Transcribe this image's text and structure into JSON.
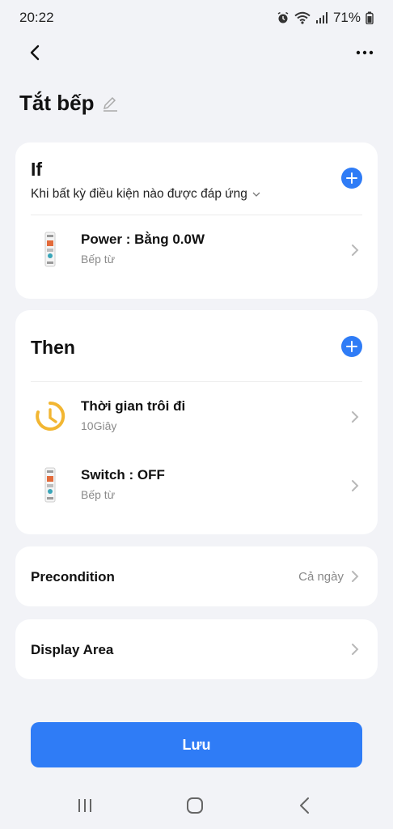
{
  "status_bar": {
    "time": "20:22",
    "battery": "71%",
    "icons": [
      "alarm-icon",
      "wifi-icon",
      "signal-icon",
      "battery-icon"
    ]
  },
  "header": {
    "title": "Tắt bếp",
    "icons": [
      "back-arrow-icon",
      "more-options-icon",
      "edit-pencil-icon"
    ]
  },
  "if_section": {
    "title": "If",
    "condition_mode": "Khi bất kỳ điều kiện nào được đáp ứng",
    "items": [
      {
        "title": "Power : Bằng 0.0W",
        "subtitle": "Bếp từ",
        "icon": "breaker-device-icon"
      }
    ]
  },
  "then_section": {
    "title": "Then",
    "items": [
      {
        "title": "Thời gian trôi đi",
        "subtitle": "10Giây",
        "icon": "delay-clock-icon"
      },
      {
        "title": "Switch : OFF",
        "subtitle": "Bếp từ",
        "icon": "breaker-device-icon"
      }
    ]
  },
  "precondition": {
    "label": "Precondition",
    "value": "Cả ngày"
  },
  "display_area": {
    "label": "Display Area"
  },
  "save_button": {
    "label": "Lưu"
  },
  "colors": {
    "accent": "#2f7cf6",
    "clock": "#f2b632",
    "background": "#f2f3f7"
  },
  "nav_bar": {
    "icons": [
      "recent-apps-icon",
      "home-icon",
      "back-icon"
    ]
  }
}
